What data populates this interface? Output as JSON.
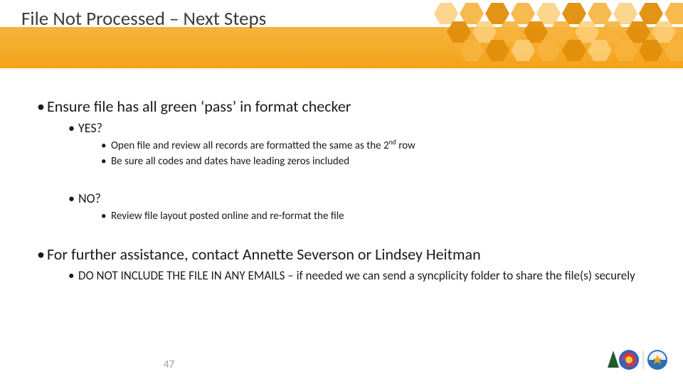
{
  "title": "File Not Processed – Next Steps",
  "bullets": {
    "l1a": "Ensure file has all green ‘pass’ in format checker",
    "l2_yes": "YES?",
    "l3_yes_1_pre": "Open file and review all records are formatted the same as the 2",
    "l3_yes_1_sup": "nd",
    "l3_yes_1_post": " row",
    "l3_yes_2": "Be sure all codes and dates have leading zeros included",
    "l2_no": "NO?",
    "l3_no_1": "Review file layout posted online and re-format the file",
    "l1b": "For further assistance, contact Annette Severson or Lindsey Heitman",
    "l2_note": "DO NOT INCLUDE THE FILE IN ANY EMAILS – if needed we can send a syncplicity folder to share the file(s) securely"
  },
  "page_number": "47",
  "colors": {
    "accent": "#f4a21a"
  }
}
